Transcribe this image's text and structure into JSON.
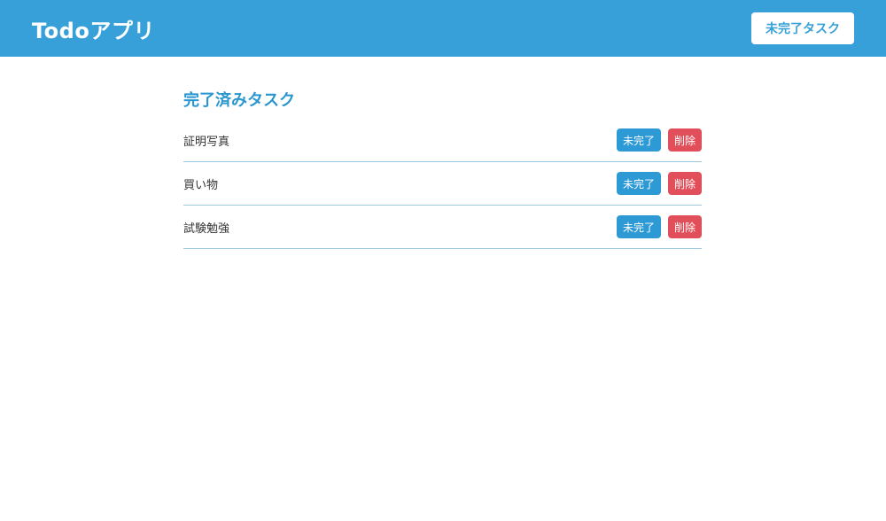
{
  "header": {
    "title": "Todoアプリ",
    "nav_button_label": "未完了タスク"
  },
  "main": {
    "section_title": "完了済みタスク",
    "tasks": [
      {
        "name": "証明写真",
        "undo_label": "未完了",
        "delete_label": "削除"
      },
      {
        "name": "買い物",
        "undo_label": "未完了",
        "delete_label": "削除"
      },
      {
        "name": "試験勉強",
        "undo_label": "未完了",
        "delete_label": "削除"
      }
    ]
  },
  "colors": {
    "header_bg": "#37a0d8",
    "accent": "#2a96d0",
    "undo_button": "#2d9ad6",
    "delete_button": "#e04f5a",
    "row_border": "#9ccbe3"
  }
}
